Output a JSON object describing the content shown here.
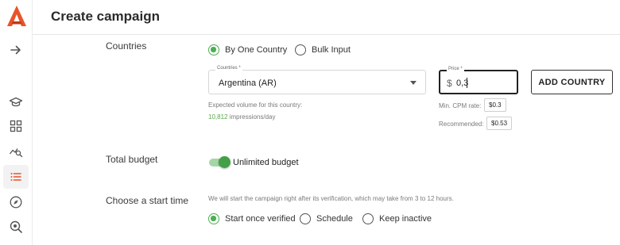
{
  "header": {
    "title": "Create campaign"
  },
  "sidebar": {
    "items": [
      {
        "icon": "arrow-right-icon"
      },
      {
        "icon": "graduation-cap-icon"
      },
      {
        "icon": "dashboard-grid-icon"
      },
      {
        "icon": "analytics-search-icon"
      },
      {
        "icon": "campaign-list-icon",
        "active": true
      },
      {
        "icon": "compass-icon"
      },
      {
        "icon": "search-settings-icon"
      }
    ],
    "accent_color": "#e8532b"
  },
  "countries": {
    "label": "Countries",
    "options": [
      {
        "label": "By One Country",
        "selected": true
      },
      {
        "label": "Bulk Input",
        "selected": false
      }
    ],
    "select": {
      "legend": "Countries *",
      "value": "Argentina (AR)"
    },
    "price": {
      "legend": "Price *",
      "currency": "$",
      "value": "0,3"
    },
    "add_button": "ADD COUNTRY",
    "volume_label": "Expected volume for this country:",
    "volume_value": "10,812",
    "volume_unit": "impressions/day",
    "min_cpm_label": "Min. CPM rate:",
    "min_cpm_value": "$0.3",
    "recommended_label": "Recommended:",
    "recommended_value": "$0.53"
  },
  "budget": {
    "label": "Total budget",
    "toggle_label": "Unlimited budget",
    "toggle_on": true
  },
  "start": {
    "label": "Choose a start time",
    "note": "We will start the campaign right after its verification, which may take from 3 to 12 hours.",
    "options": [
      {
        "label": "Start once verified",
        "selected": true
      },
      {
        "label": "Schedule",
        "selected": false
      },
      {
        "label": "Keep inactive",
        "selected": false
      }
    ]
  },
  "colors": {
    "green": "#4caf50",
    "brand": "#e8532b"
  }
}
